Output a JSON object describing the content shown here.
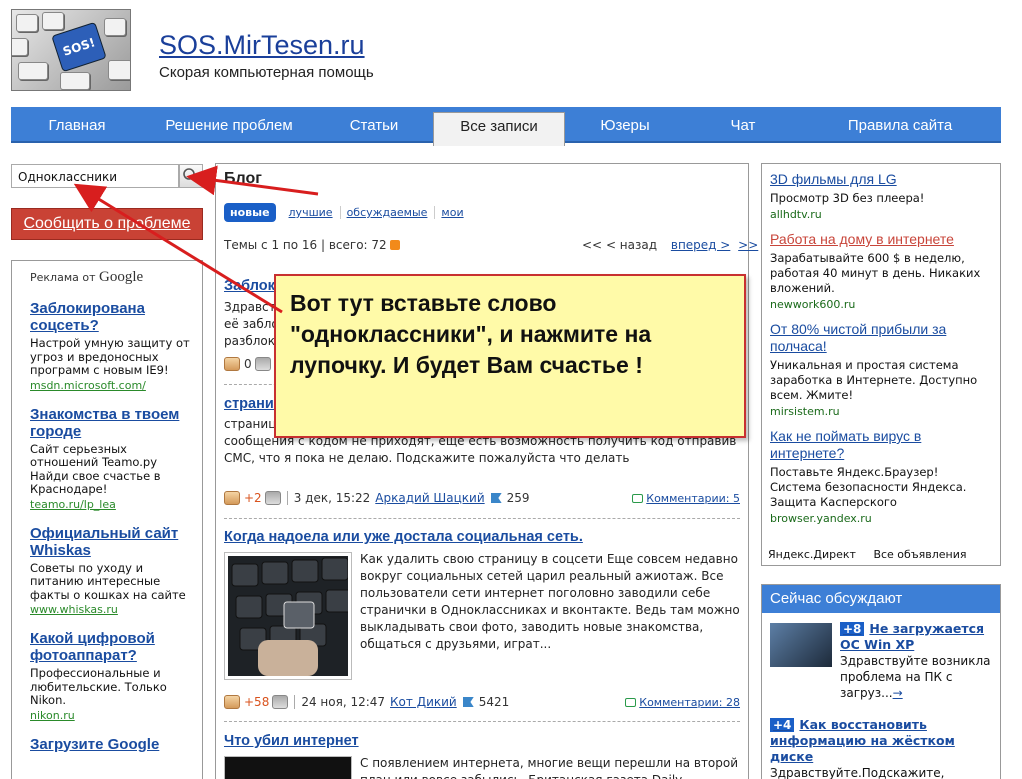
{
  "header": {
    "logo_text": "SOS!",
    "site_title": "SOS.MirTesen.ru",
    "subtitle": "Скорая компьютерная помощь"
  },
  "nav": {
    "tabs": [
      {
        "label": "Главная"
      },
      {
        "label": "Решение проблем"
      },
      {
        "label": "Статьи"
      },
      {
        "label": "Все записи",
        "active": true
      },
      {
        "label": "Юзеры"
      },
      {
        "label": "Чат"
      },
      {
        "label": "Правила сайта"
      }
    ]
  },
  "search": {
    "value": "Одноклассники",
    "icon": "magnifier-icon"
  },
  "report_button": "Сообщить о проблеме",
  "left_ads": {
    "label": "Реклама от",
    "brand": "Google",
    "items": [
      {
        "title": "Заблокирована соцсеть?",
        "desc": "Настрой умную защиту от угроз и вредоносных программ с новым IE9!",
        "url": "msdn.microsoft.com/"
      },
      {
        "title": "Знакомства в твоем городе",
        "desc": "Сайт серьезных отношений Teamo.ру Найди свое счастье в Краснодаре!",
        "url": "teamo.ru/lp_lea"
      },
      {
        "title": "Официальный сайт Whiskas",
        "desc": "Советы по уходу и питанию интересные факты о кошках на сайте",
        "url": "www.whiskas.ru"
      },
      {
        "title": "Какой цифровой фотоаппарат?",
        "desc": "Профессиональные и любительские. Только Nikon.",
        "url": "nikon.ru"
      },
      {
        "title": "Загрузите Google",
        "desc": "",
        "url": ""
      }
    ]
  },
  "blog": {
    "title": "Блог",
    "filters": {
      "active": "новые",
      "others": [
        "лучшие",
        "обсуждаемые",
        "мои"
      ]
    },
    "topics_count": "Темы с 1 по 16  |  всего: 72",
    "pager": {
      "first": "<<",
      "prev": "< назад",
      "next": "вперед >",
      "last": ">>"
    },
    "posts": [
      {
        "title": "Заблокирован...",
        "text": "Здравствуйте! ...\nеё заблок...\nразблокиро...",
        "rating": "0"
      },
      {
        "title": "страница...",
        "text": "страница ... \nвзлом! Требует пройти валидацию через мобильный телефон, но сообщения с кодом не приходят, ещё есть возможность получить код отправив СМС, что я пока не делаю. Подскажите пожалуйста что делать",
        "rating": "+2",
        "date": "3 дек, 15:22",
        "author": "Аркадий Шацкий",
        "views": "259",
        "comments": "Комментарии: 5"
      },
      {
        "title": "Когда надоела или уже достала социальная сеть.",
        "text": "Как удалить свою страницу в соцсети Еще совсем недавно вокруг социальных сетей царил реальный ажиотаж. Все пользователи сети интернет поголовно заводили себе странички в Одноклассниках и вконтакте. Ведь там можно выкладывать свои фото, заводить новые знакомства, общаться с друзьями, играт...",
        "rating": "+58",
        "date": "24 ноя, 12:47",
        "author": "Кот Дикий",
        "views": "5421",
        "comments": "Комментарии: 28"
      },
      {
        "title": "Что убил интернет",
        "text": "С появлением интернета, многие вещи перешли на второй план или вовсе забылись. Британская газета Daily Telegraph",
        "rating": "",
        "date": "",
        "author": "",
        "views": "",
        "comments": ""
      }
    ]
  },
  "note": "Вот тут вставьте слово \"одноклассники\", и нажмите на лупочку. И будет Вам счастье !",
  "right_ads": {
    "items": [
      {
        "title": "3D фильмы для LG",
        "desc": "Просмотр 3D без плеера!",
        "url": "allhdtv.ru",
        "color": "#1a4ca0"
      },
      {
        "title": "Работа на дому в интернете",
        "desc": "Зарабатывайте 600 $ в неделю, работая 40 минут в день. Никаких вложений.",
        "url": "newwork600.ru",
        "color": "#c8453a"
      },
      {
        "title": "От 80% чистой прибыли за полчаса!",
        "desc": "Уникальная и простая система заработка в Интернете. Доступно всем. Жмите!",
        "url": "mirsistem.ru",
        "color": "#1a4ca0"
      },
      {
        "title": "Как не поймать вирус в интернете?",
        "desc": "Поставьте Яндекс.Браузер! Система безопасности Яндекса. Защита Касперского",
        "url": "browser.yandex.ru",
        "color": "#1a4ca0"
      }
    ],
    "footer_brand": "Яндекс.Директ",
    "footer_all": "Все объявления"
  },
  "discuss": {
    "title": "Сейчас обсуждают",
    "items": [
      {
        "count": "+8",
        "title": "Не загружается ОС Win XP",
        "text": "Здравствуйте возникла проблема на ПК с загруз...",
        "more": "→"
      },
      {
        "count": "+4",
        "title": "Как восстановить информацию на жёстком диске",
        "text": "Здравствуйте.Подскажите, пожалуйста что можно...",
        "more": ""
      }
    ]
  }
}
